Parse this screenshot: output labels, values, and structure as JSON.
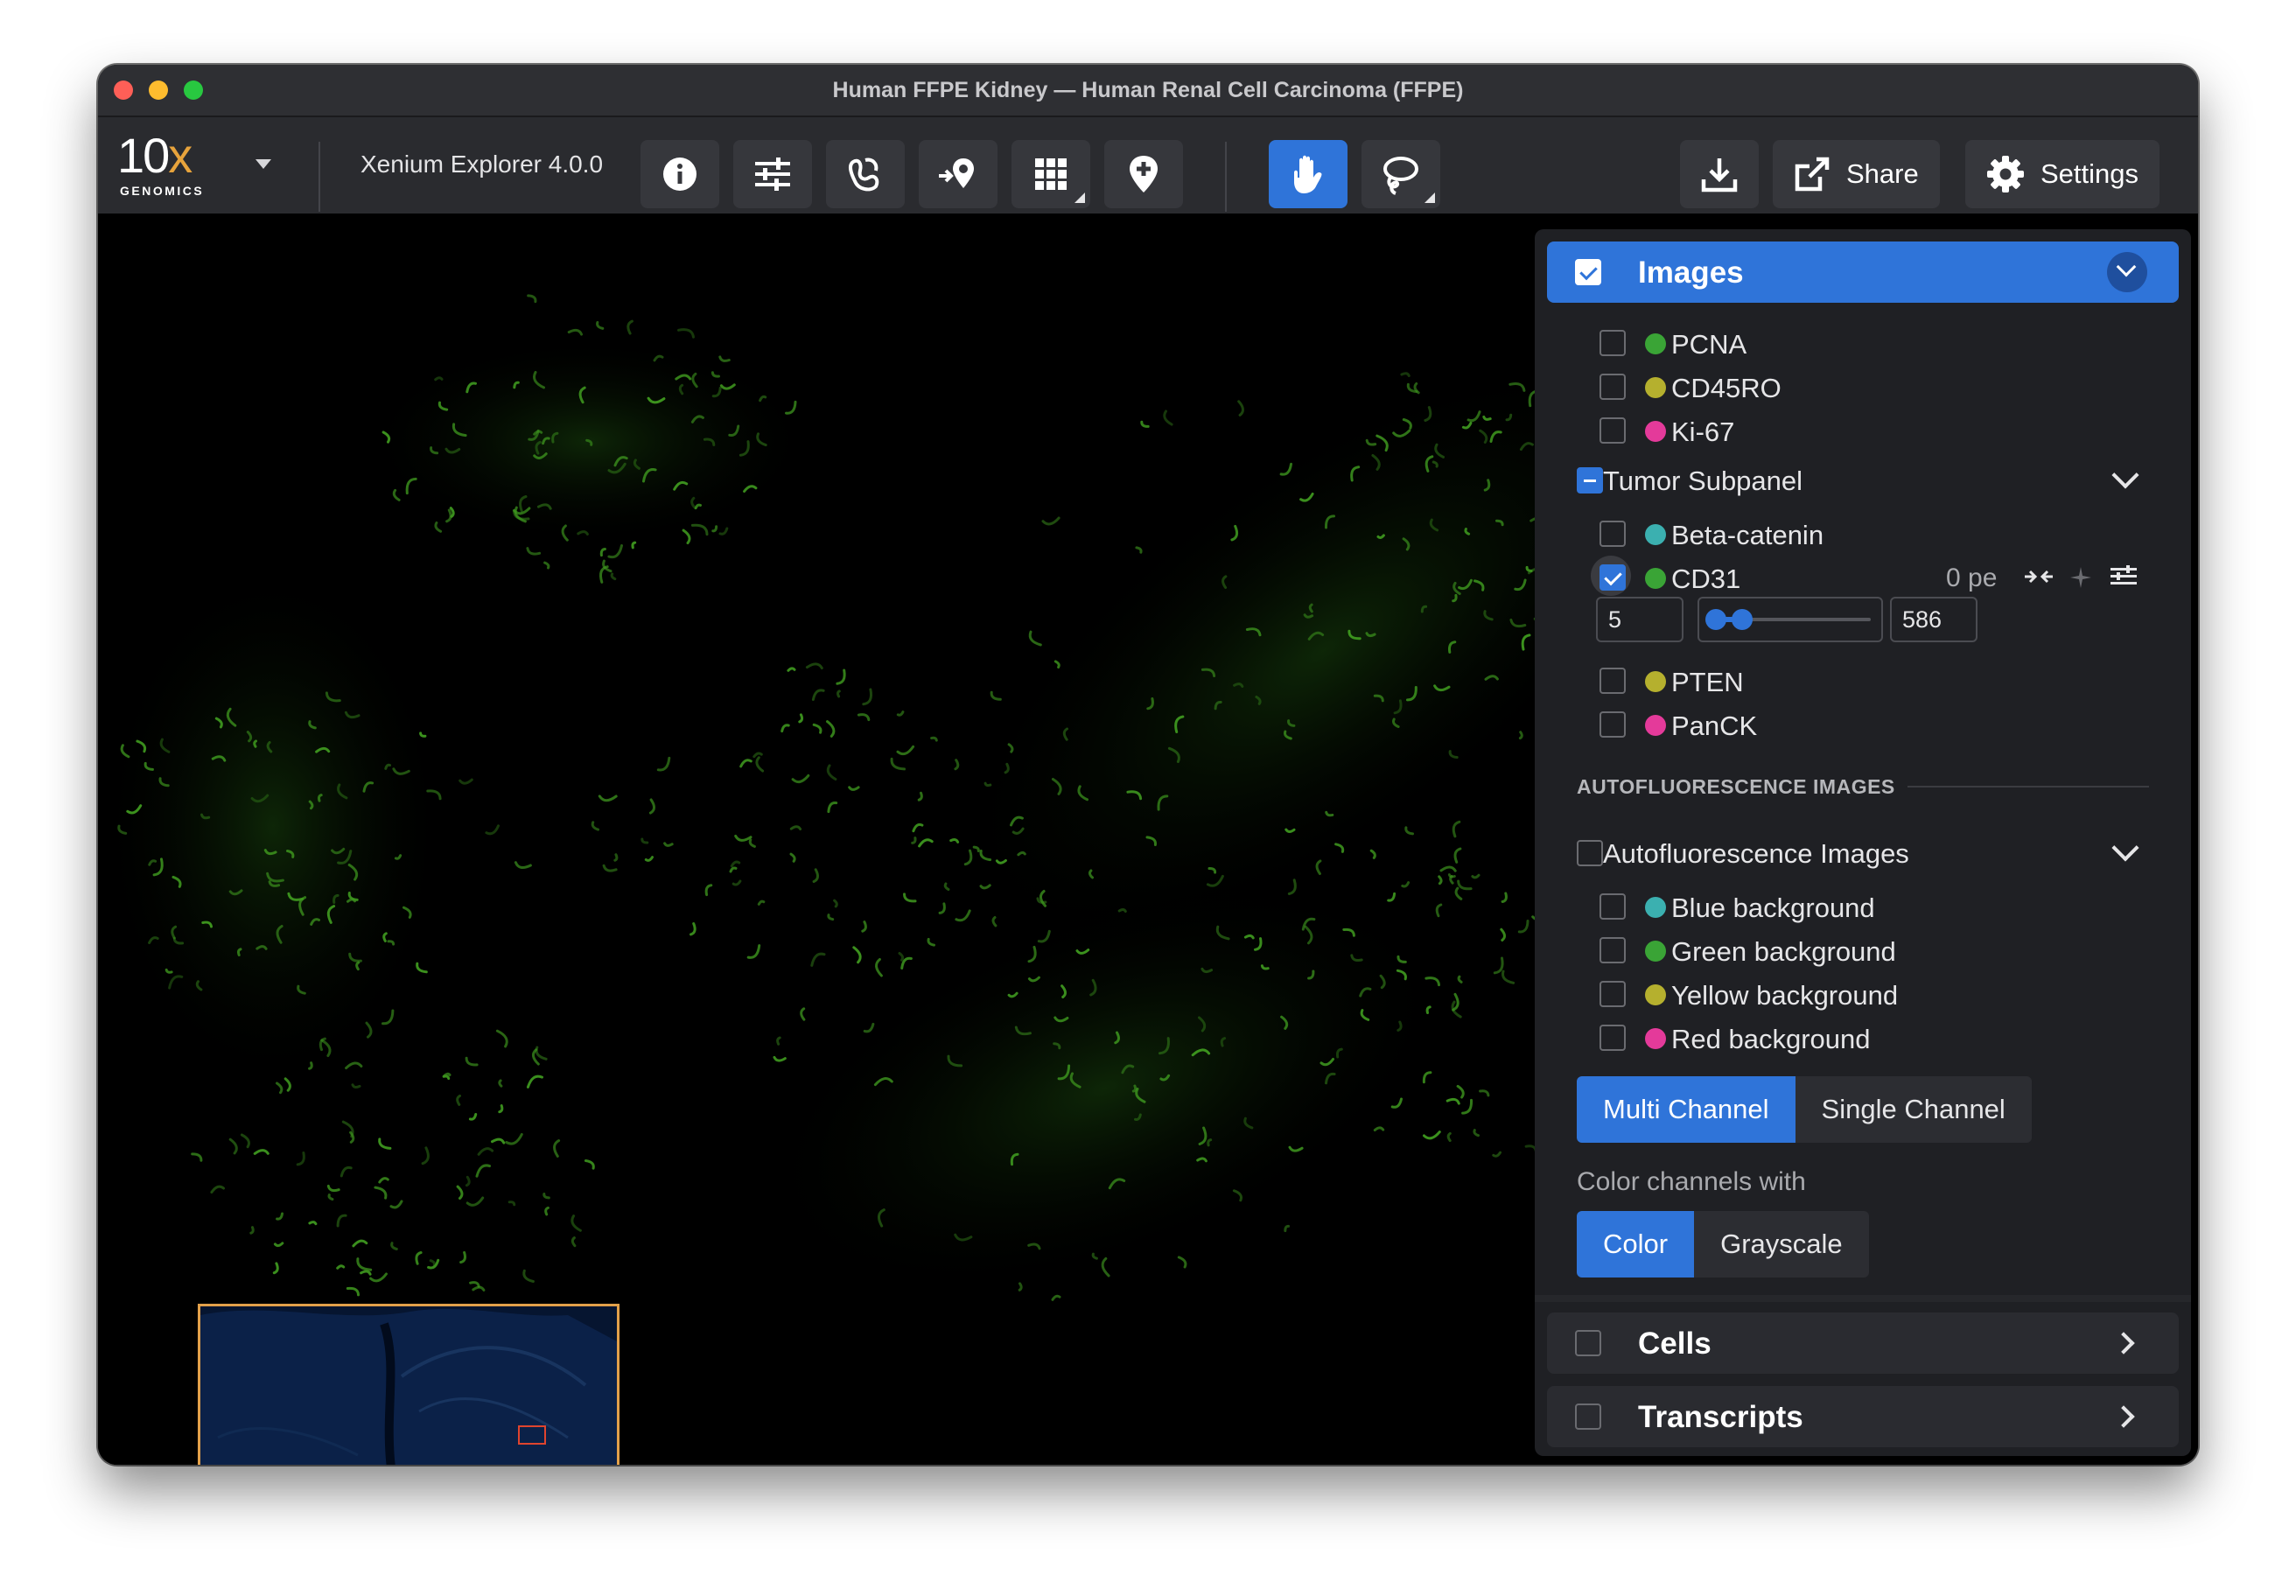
{
  "window": {
    "title": "Human FFPE Kidney — Human Renal Cell Carcinoma (FFPE)"
  },
  "toolbar": {
    "logo_main": "10",
    "logo_x": "x",
    "logo_sub": "GENOMICS",
    "app_version": "Xenium Explorer 4.0.0",
    "share_label": "Share",
    "settings_label": "Settings"
  },
  "panel": {
    "images_header": "Images",
    "protein_channels": [
      {
        "name": "PCNA",
        "color": "#3aa436",
        "checked": false
      },
      {
        "name": "CD45RO",
        "color": "#b5b02e",
        "checked": false
      },
      {
        "name": "Ki-67",
        "color": "#e43a9a",
        "checked": false
      }
    ],
    "tumor_group": "Tumor Subpanel",
    "tumor_channels": [
      {
        "name": "Beta-catenin",
        "color": "#3bb0b0",
        "checked": false
      },
      {
        "name": "CD31",
        "color": "#3aa436",
        "checked": true
      },
      {
        "name": "PTEN",
        "color": "#b5b02e",
        "checked": false
      },
      {
        "name": "PanCK",
        "color": "#e43a9a",
        "checked": false
      }
    ],
    "cd31_meta": "0 pe",
    "range_min": "5",
    "range_max": "586",
    "range_slider": {
      "low_fraction": 0.04,
      "high_fraction": 0.2
    },
    "autofluorescence_caption": "AUTOFLUORESCENCE IMAGES",
    "autofluorescence_group": "Autofluorescence Images",
    "autofluorescence_channels": [
      {
        "name": "Blue background",
        "color": "#3bb0b0",
        "checked": false
      },
      {
        "name": "Green background",
        "color": "#3aa436",
        "checked": false
      },
      {
        "name": "Yellow background",
        "color": "#b5b02e",
        "checked": false
      },
      {
        "name": "Red background",
        "color": "#e43a9a",
        "checked": false
      }
    ],
    "mode_multi": "Multi Channel",
    "mode_single": "Single Channel",
    "color_channels_label": "Color channels with",
    "color_option": "Color",
    "grayscale_option": "Grayscale",
    "cells_header": "Cells",
    "transcripts_header": "Transcripts"
  },
  "colors": {
    "accent": "#2f74d9",
    "toolbar_bg": "#2a2b2f",
    "panel_bg": "#1f2024",
    "minimap_border": "#e2a04a",
    "minimap_viewport": "#e0442e"
  }
}
